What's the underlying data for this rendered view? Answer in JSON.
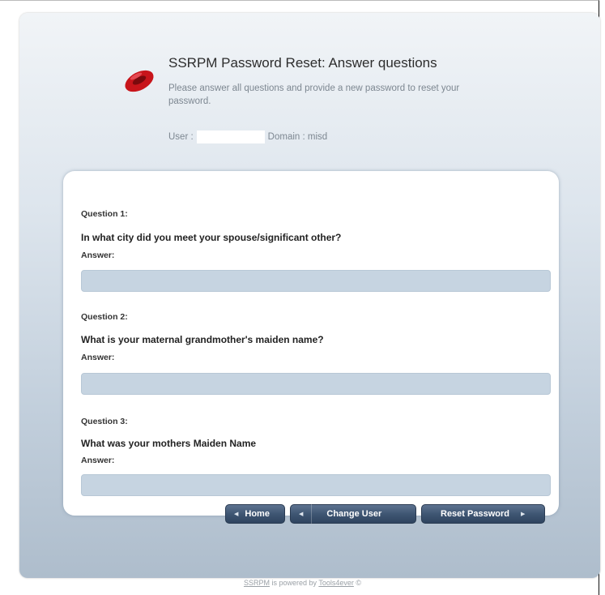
{
  "header": {
    "title": "SSRPM Password Reset: Answer questions",
    "subtitle": "Please answer all questions and provide a new password to reset your password.",
    "user_label": "User :",
    "user_value": "",
    "domain_label": "Domain : misd"
  },
  "questions": [
    {
      "label": "Question 1:",
      "text": "In what city did you meet your spouse/significant other?",
      "answer_label": "Answer:",
      "answer_value": ""
    },
    {
      "label": "Question 2:",
      "text": "What is your maternal grandmother's maiden name?",
      "answer_label": "Answer:",
      "answer_value": ""
    },
    {
      "label": "Question 3:",
      "text": "What was your mothers Maiden Name",
      "answer_label": "Answer:",
      "answer_value": ""
    }
  ],
  "buttons": {
    "home": "Home",
    "change_user": "Change User",
    "reset_password": "Reset Password"
  },
  "footer": {
    "product_link": "SSRPM",
    "middle_text": " is powered by ",
    "vendor_link": "Tools4ever",
    "icon": "copyright-icon"
  },
  "colors": {
    "logo_red": "#c8151b",
    "button_navy": "#3f5673",
    "input_fill": "#c6d4e1"
  }
}
